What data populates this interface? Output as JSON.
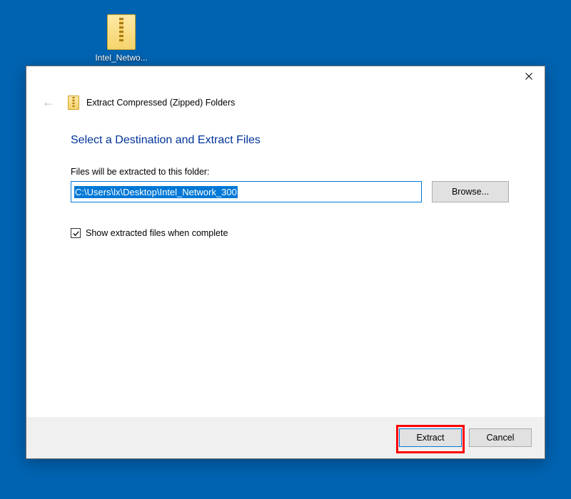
{
  "desktop": {
    "icon_label": "Intel_Netwo..."
  },
  "dialog": {
    "title": "Extract Compressed (Zipped) Folders",
    "heading": "Select a Destination and Extract Files",
    "path_label": "Files will be extracted to this folder:",
    "path_value": "C:\\Users\\lx\\Desktop\\Intel_Network_300",
    "browse_label": "Browse...",
    "checkbox_label": "Show extracted files when complete",
    "checkbox_checked": true,
    "extract_label": "Extract",
    "cancel_label": "Cancel"
  }
}
